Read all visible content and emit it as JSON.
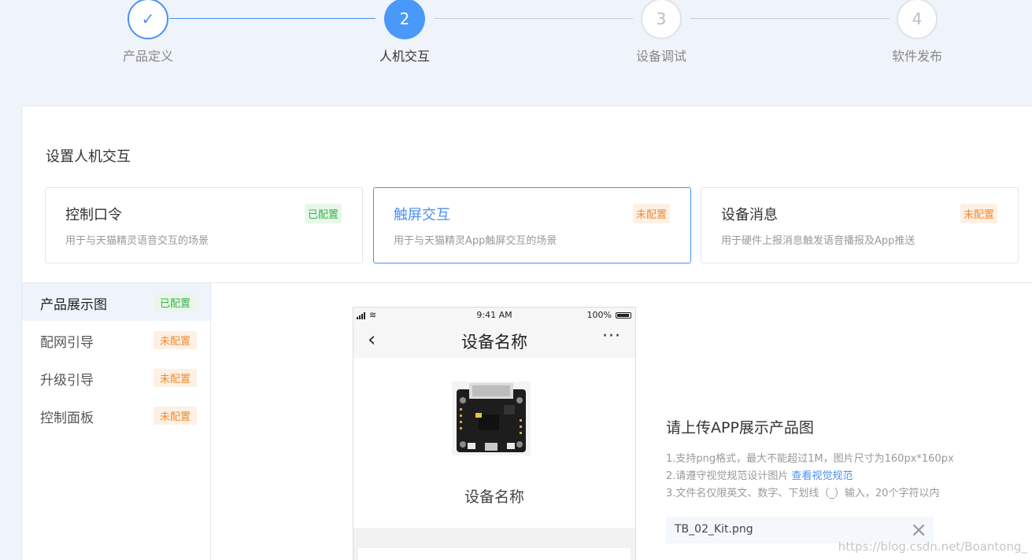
{
  "stepper": {
    "steps": [
      {
        "number": "✓",
        "label": "产品定义",
        "state": "done"
      },
      {
        "number": "2",
        "label": "人机交互",
        "state": "active"
      },
      {
        "number": "3",
        "label": "设备调试",
        "state": "todo"
      },
      {
        "number": "4",
        "label": "软件发布",
        "state": "todo"
      }
    ]
  },
  "panel": {
    "title": "设置人机交互",
    "cards": [
      {
        "title": "控制口令",
        "desc": "用于与天猫精灵语音交互的场景",
        "badge": "已配置"
      },
      {
        "title": "触屏交互",
        "desc": "用于与天猫精灵App触屏交互的场景",
        "badge": "未配置"
      },
      {
        "title": "设备消息",
        "desc": "用于硬件上报消息触发语音播报及App推送",
        "badge": "未配置"
      }
    ]
  },
  "subnav": {
    "items": [
      {
        "label": "产品展示图",
        "badge": "已配置"
      },
      {
        "label": "配网引导",
        "badge": "未配置"
      },
      {
        "label": "升级引导",
        "badge": "未配置"
      },
      {
        "label": "控制面板",
        "badge": "未配置"
      }
    ]
  },
  "phone": {
    "time": "9:41 AM",
    "battery": "100%",
    "title": "设备名称",
    "more": "···",
    "device_name": "设备名称"
  },
  "upload": {
    "title": "请上传APP展示产品图",
    "tip1": "1.支持png格式，最大不能超过1M，图片尺寸为160px*160px",
    "tip2": "2.请遵守视觉规范设计图片",
    "tip2_link": "查看视觉规范",
    "tip3": "3.文件名仅限英文、数字、下划线（_）输入，20个字符以内",
    "file_name": "TB_02_Kit.png"
  },
  "watermark": "https://blog.csdn.net/Boantong_",
  "colors": {
    "accent": "#4a90f5",
    "ok": "#37b24d",
    "warn": "#f08c33"
  }
}
